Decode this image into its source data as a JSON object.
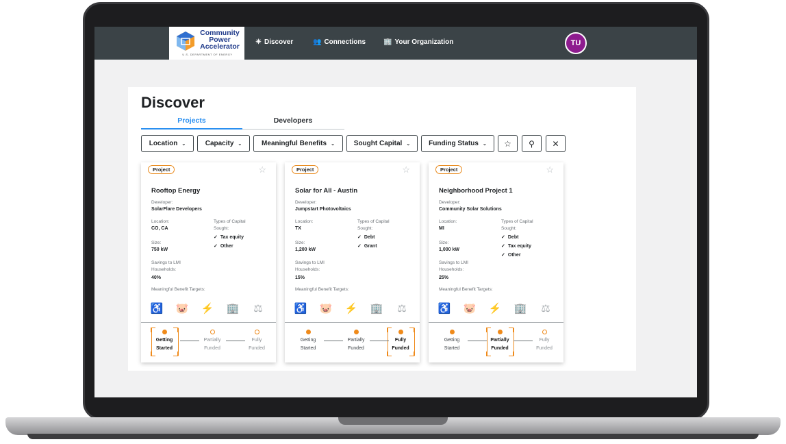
{
  "nav": {
    "logo_line1": "Community",
    "logo_line2": "Power",
    "logo_line3": "Accelerator",
    "logo_sub": "U.S. DEPARTMENT OF ENERGY",
    "items": [
      {
        "label": "Discover",
        "icon": "sun-icon"
      },
      {
        "label": "Connections",
        "icon": "people-icon"
      },
      {
        "label": "Your Organization",
        "icon": "building-icon"
      }
    ],
    "avatar_initials": "TU",
    "avatar_color": "#8e1c8f"
  },
  "page": {
    "title": "Discover",
    "tabs": [
      {
        "label": "Projects",
        "active": true
      },
      {
        "label": "Developers",
        "active": false
      }
    ],
    "filters": [
      "Location",
      "Capacity",
      "Meaningful Benefits",
      "Sought Capital",
      "Funding Status"
    ],
    "filter_icons": [
      "star-icon",
      "search-icon",
      "close-icon"
    ]
  },
  "labels": {
    "badge": "Project",
    "developer": "Developer:",
    "location": "Location:",
    "capital": "Types of Capital Sought:",
    "size": "Size:",
    "savings": "Savings to LMI Households:",
    "benefits": "Meaningful Benefit Targets:"
  },
  "accent_color": "#ef8a1a",
  "link_color": "#2a8ff0",
  "cards": [
    {
      "title": "Rooftop Energy",
      "developer": "SolarFlare Developers",
      "location": "CO, CA",
      "size": "750 kW",
      "savings": "40%",
      "capital": [
        "Tax equity",
        "Other"
      ],
      "benefits_active": [
        false,
        true,
        false,
        false,
        false
      ],
      "stages": [
        {
          "l1": "Getting",
          "l2": "Started",
          "state": "current"
        },
        {
          "l1": "Partially",
          "l2": "Funded",
          "state": "future"
        },
        {
          "l1": "Fully",
          "l2": "Funded",
          "state": "future"
        }
      ]
    },
    {
      "title": "Solar for All - Austin",
      "developer": "Jumpstart Photovoltaics",
      "location": "TX",
      "size": "1,200 kW",
      "savings": "15%",
      "capital": [
        "Debt",
        "Grant"
      ],
      "benefits_active": [
        true,
        false,
        true,
        true,
        false
      ],
      "stages": [
        {
          "l1": "Getting",
          "l2": "Started",
          "state": "past"
        },
        {
          "l1": "Partially",
          "l2": "Funded",
          "state": "past"
        },
        {
          "l1": "Fully",
          "l2": "Funded",
          "state": "current"
        }
      ]
    },
    {
      "title": "Neighborhood Project 1",
      "developer": "Community Solar Solutions",
      "location": "MI",
      "size": "1,000 kW",
      "savings": "25%",
      "capital": [
        "Debt",
        "Tax equity",
        "Other"
      ],
      "benefits_active": [
        false,
        false,
        true,
        true,
        false
      ],
      "stages": [
        {
          "l1": "Getting",
          "l2": "Started",
          "state": "past"
        },
        {
          "l1": "Partially",
          "l2": "Funded",
          "state": "current"
        },
        {
          "l1": "Fully",
          "l2": "Funded",
          "state": "future"
        }
      ]
    }
  ]
}
